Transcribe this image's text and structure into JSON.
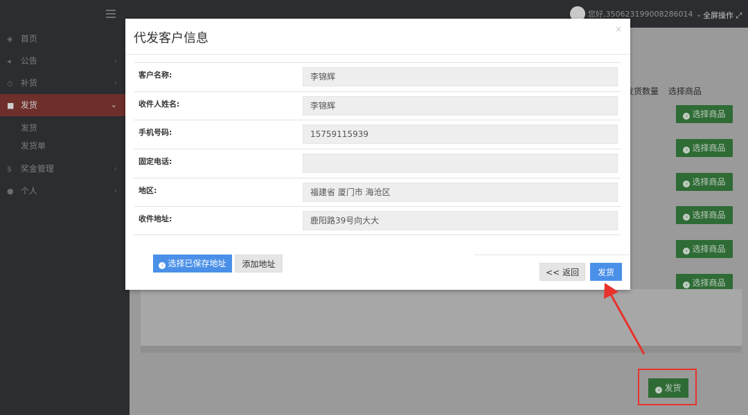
{
  "topbar": {
    "user_greeting": "您好,350623199008286014",
    "fullscreen_label": "全屏操作"
  },
  "sidebar": {
    "items": [
      {
        "label": "首页",
        "icon": "dashboard-icon"
      },
      {
        "label": "公告",
        "icon": "bullhorn-icon"
      },
      {
        "label": "补货",
        "icon": "tag-icon"
      },
      {
        "label": "发货",
        "icon": "truck-icon"
      },
      {
        "label": "奖金管理",
        "icon": "dollar-icon"
      },
      {
        "label": "个人",
        "icon": "user-icon"
      }
    ],
    "sub_items": [
      "发货",
      "发货单"
    ]
  },
  "background": {
    "col_qty": "发货数量",
    "col_select": "选择商品",
    "select_button_label": "选择商品",
    "ship_button_label": "发货"
  },
  "modal": {
    "title": "代发客户信息",
    "close": "×",
    "fields": [
      {
        "label": "客户名称:",
        "value": "李锦辉"
      },
      {
        "label": "收件人姓名:",
        "value": "李锦辉"
      },
      {
        "label": "手机号码:",
        "value": "15759115939"
      },
      {
        "label": "固定电话:",
        "value": ""
      },
      {
        "label": "地区:",
        "value": "福建省 厦门市 海沧区"
      },
      {
        "label": "收件地址:",
        "value": "鹿阳路39号向大大"
      }
    ],
    "btn_saved_address": "选择已保存地址",
    "btn_add_address": "添加地址",
    "btn_back": "<< 返回",
    "btn_ship": "发货"
  },
  "colors": {
    "accent_blue": "#4a90e8",
    "green_button": "#2e6b35",
    "annotation_red": "#e8322b",
    "active_nav": "#6e2f2b"
  }
}
